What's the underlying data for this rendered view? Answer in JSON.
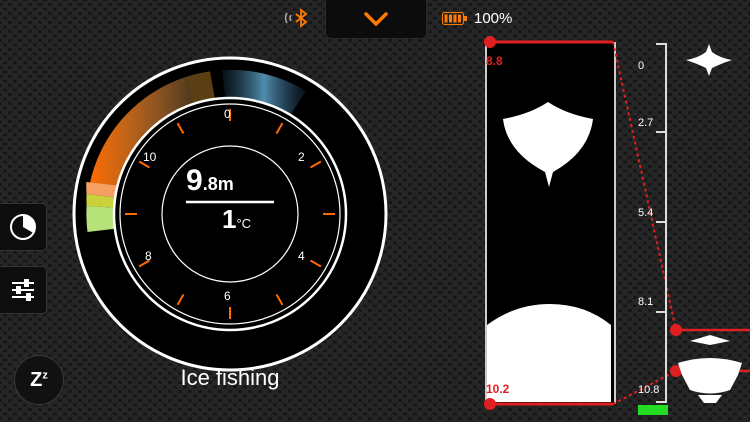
{
  "status": {
    "battery_text": "100%",
    "bluetooth_icon": "bluetooth-icon",
    "expand_icon": "chevron-down-icon"
  },
  "dial": {
    "depth_value": "9",
    "depth_decimal": ".8m",
    "temperature_value": "1",
    "temperature_unit": "°C",
    "labels": [
      "0",
      "2",
      "4",
      "6",
      "8",
      "10"
    ],
    "accent_color": "#ff6a00"
  },
  "sidebar": {
    "history_icon": "clock-icon",
    "settings_icon": "sliders-icon",
    "sleep_label": "Z",
    "sleep_sup": "z"
  },
  "mode_label": "Ice fishing",
  "sonar": {
    "top_depth": "8.8",
    "bottom_depth": "10.2",
    "line_color": "#e02020"
  },
  "scale": {
    "ticks": [
      "0",
      "2.7",
      "5.4",
      "8.1",
      "10.8"
    ]
  }
}
